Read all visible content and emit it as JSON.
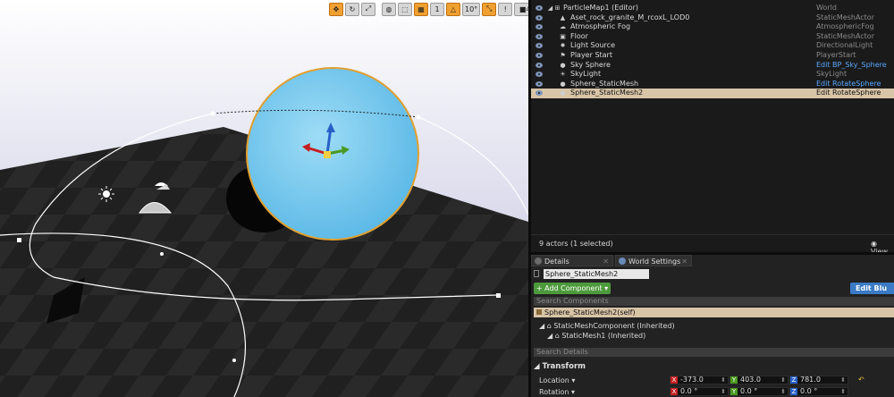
{
  "viewport": {
    "toolbar": {
      "rotation_snap": "10°",
      "camera_speed": "4"
    }
  },
  "outliner": {
    "rows": [
      {
        "name": "ParticleMap1 (Editor)",
        "type": "World",
        "type_link": false,
        "selected": false
      },
      {
        "name": "Aset_rock_granite_M_rcoxL_LOD0",
        "type": "StaticMeshActor",
        "type_link": false,
        "selected": false
      },
      {
        "name": "Atmospheric Fog",
        "type": "AtmosphericFog",
        "type_link": false,
        "selected": false
      },
      {
        "name": "Floor",
        "type": "StaticMeshActor",
        "type_link": false,
        "selected": false
      },
      {
        "name": "Light Source",
        "type": "DirectionalLight",
        "type_link": false,
        "selected": false
      },
      {
        "name": "Player Start",
        "type": "PlayerStart",
        "type_link": false,
        "selected": false
      },
      {
        "name": "Sky Sphere",
        "type": "Edit BP_Sky_Sphere",
        "type_link": true,
        "selected": false
      },
      {
        "name": "SkyLight",
        "type": "SkyLight",
        "type_link": false,
        "selected": false
      },
      {
        "name": "Sphere_StaticMesh",
        "type": "Edit RotateSphere",
        "type_link": true,
        "selected": false
      },
      {
        "name": "Sphere_StaticMesh2",
        "type": "Edit RotateSphere",
        "type_link": false,
        "selected": true
      }
    ],
    "status": "9 actors (1 selected)",
    "view_label": "View"
  },
  "details": {
    "tabs": [
      "Details",
      "World Settings"
    ],
    "actor_name": "Sphere_StaticMesh2",
    "add_component": "+ Add Component ▾",
    "edit_blueprint": "Edit Blu",
    "search_components_placeholder": "Search Components",
    "self_component": "Sphere_StaticMesh2(self)",
    "components": [
      "StaticMeshComponent (Inherited)",
      "StaticMesh1 (Inherited)"
    ],
    "search_details_placeholder": "Search Details",
    "section": "Transform",
    "location": {
      "label": "Location ▾",
      "x": "-373.0",
      "y": "403.0",
      "z": "781.0"
    },
    "rotation": {
      "label": "Rotation ▾",
      "x": "0.0 °",
      "y": "0.0 °",
      "z": "0.0 °"
    }
  },
  "colors": {
    "sphere": "#6cc6ee",
    "selection_outline": "#e0a030",
    "add_button": "#4d9a3c",
    "edit_button": "#3a7ac6",
    "selected_row": "#d8c4a6",
    "axis_x": "#c42020",
    "axis_y": "#4a9a20",
    "axis_z": "#2860c8"
  }
}
